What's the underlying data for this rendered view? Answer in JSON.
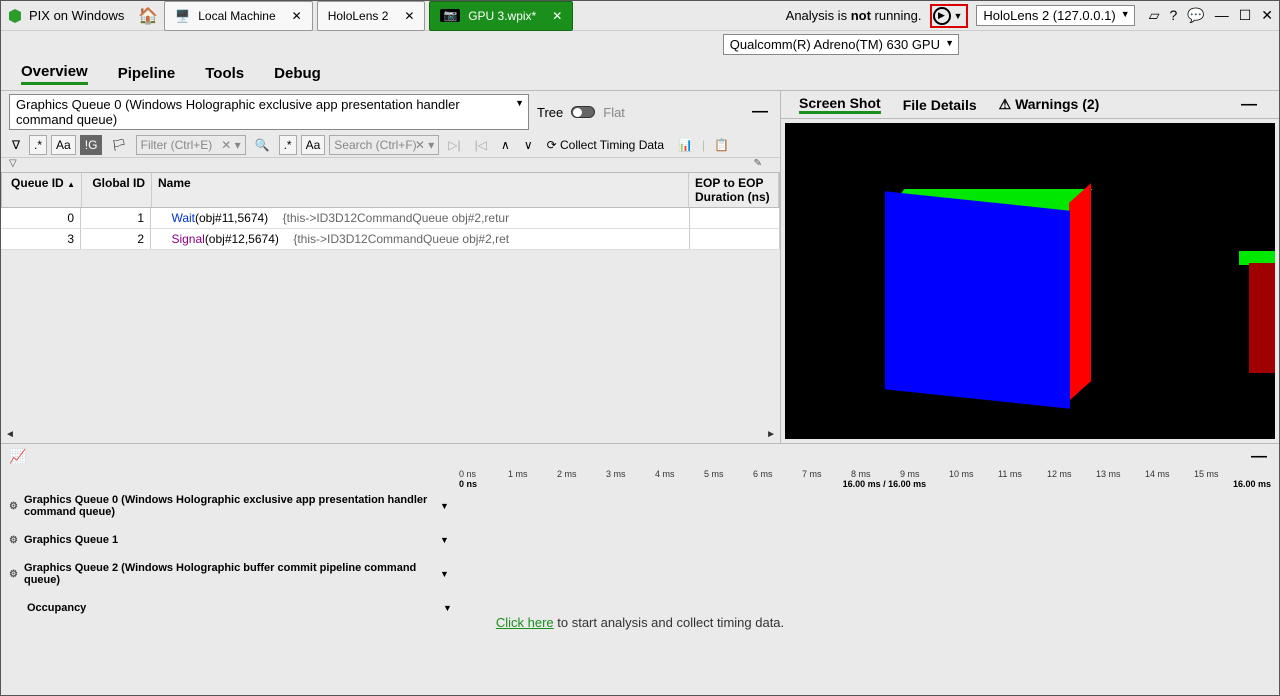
{
  "app": {
    "title": "PIX on Windows"
  },
  "tabs": [
    {
      "icon": "monitor",
      "label": "Local Machine"
    },
    {
      "icon": "monitor",
      "label": "HoloLens 2"
    },
    {
      "icon": "camera",
      "label": "GPU 3.wpix*",
      "active": true
    }
  ],
  "status": {
    "prefix": "Analysis is ",
    "bold": "not",
    "suffix": " running."
  },
  "device_dropdown": "HoloLens 2 (127.0.0.1)",
  "gpu_dropdown": "Qualcomm(R) Adreno(TM) 630 GPU",
  "menu": {
    "overview": "Overview",
    "pipeline": "Pipeline",
    "tools": "Tools",
    "debug": "Debug"
  },
  "queue_select": "Graphics Queue 0 (Windows Holographic exclusive app presentation handler command queue)",
  "tree_label": "Tree",
  "flat_label": "Flat",
  "filter1": {
    "regex": ".*",
    "case": "Aa",
    "ig": "!G",
    "placeholder": "Filter (Ctrl+E)"
  },
  "filter2": {
    "regex": ".*",
    "case": "Aa",
    "placeholder": "Search (Ctrl+F)"
  },
  "collect_label": "Collect Timing Data",
  "columns": {
    "queue_id": "Queue ID",
    "global_id": "Global ID",
    "name": "Name",
    "eop": "EOP to EOP Duration (ns)"
  },
  "rows": [
    {
      "qid": "0",
      "gid": "1",
      "kw": "Wait",
      "kwClass": "kw-wait",
      "call": "(obj#11,5674)",
      "rest": "{this->ID3D12CommandQueue obj#2,retur"
    },
    {
      "qid": "3",
      "gid": "2",
      "kw": "Signal",
      "kwClass": "kw-sig",
      "call": "(obj#12,5674)",
      "rest": "{this->ID3D12CommandQueue obj#2,ret"
    }
  ],
  "right_tabs": {
    "screenshot": "Screen Shot",
    "file_details": "File Details",
    "warnings": "Warnings (2)"
  },
  "ruler_top": [
    "0 ns",
    "1 ms",
    "2 ms",
    "3 ms",
    "4 ms",
    "5 ms",
    "6 ms",
    "7 ms",
    "8 ms",
    "9 ms",
    "10 ms",
    "11 ms",
    "12 ms",
    "13 ms",
    "14 ms",
    "15 ms"
  ],
  "ruler_bottom_left": "0 ns",
  "ruler_bottom_mid": "16.00 ms / 16.00 ms",
  "ruler_bottom_right": "16.00 ms",
  "lanes": [
    {
      "label": "Graphics Queue 0 (Windows Holographic exclusive app presentation handler command queue)"
    },
    {
      "label": "Graphics Queue 1"
    },
    {
      "label": "Graphics Queue 2 (Windows Holographic buffer commit pipeline command queue)"
    },
    {
      "label": "Occupancy",
      "noGear": true
    }
  ],
  "hint": {
    "link": "Click here",
    "rest": " to start analysis and collect timing data."
  }
}
